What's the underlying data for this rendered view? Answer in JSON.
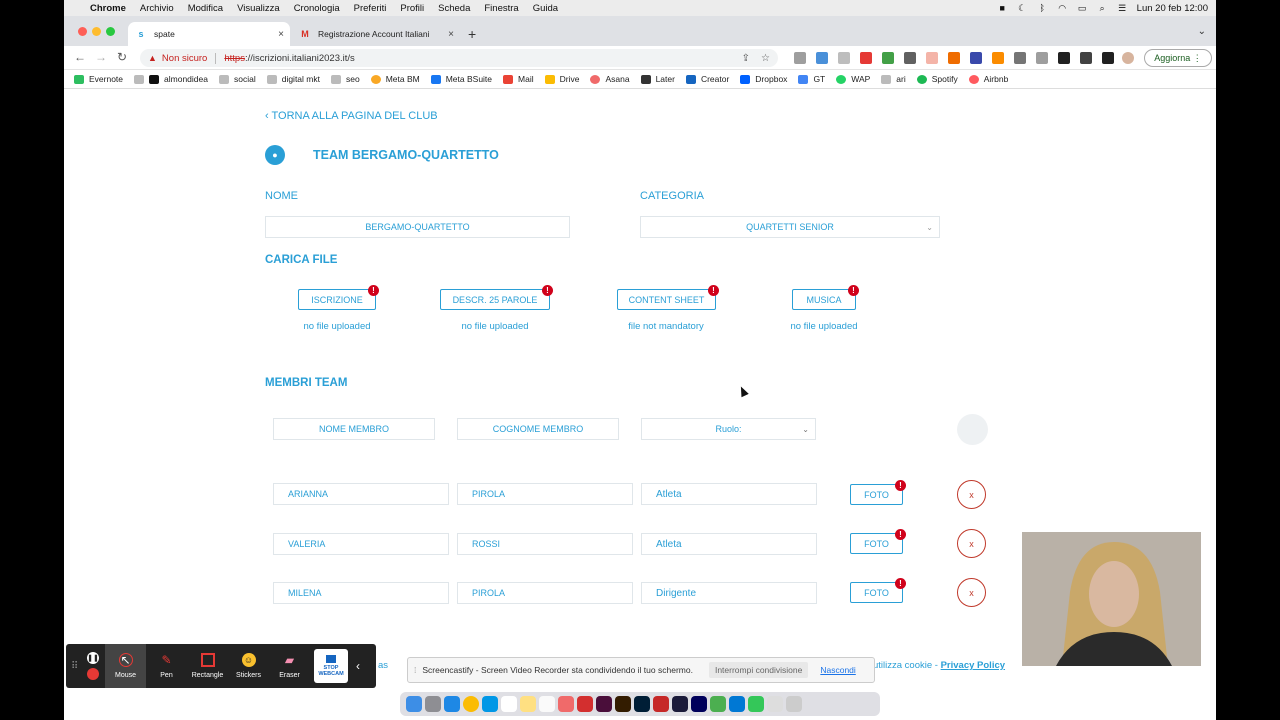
{
  "menubar": {
    "app": "Chrome",
    "items": [
      "Archivio",
      "Modifica",
      "Visualizza",
      "Cronologia",
      "Preferiti",
      "Profili",
      "Scheda",
      "Finestra",
      "Guida"
    ],
    "clock": "Lun 20 feb  12:00"
  },
  "browser": {
    "tabs": [
      {
        "title": "spate",
        "active": true
      },
      {
        "title": "Registrazione Account Italiani",
        "active": false
      }
    ],
    "security": "Non sicuro",
    "url_scheme": "https",
    "url_rest": "://iscrizioni.italiani2023.it/s",
    "update_button": "Aggiorna",
    "bookmarks": [
      "Evernote",
      "almondidea",
      "social",
      "digital mkt",
      "seo",
      "Meta BM",
      "Meta BSuite",
      "Mail",
      "Drive",
      "Asana",
      "Later",
      "Creator",
      "Dropbox",
      "GT",
      "WAP",
      "ari",
      "Spotify",
      "Airbnb"
    ]
  },
  "page": {
    "back_link": "‹ TORNA ALLA PAGINA DEL CLUB",
    "team_title": "TEAM BERGAMO-QUARTETTO",
    "nome_label": "NOME",
    "nome_value": "BERGAMO-QUARTETTO",
    "categoria_label": "CATEGORIA",
    "categoria_value": "QUARTETTI SENIOR",
    "carica_file": "CARICA FILE",
    "files": [
      {
        "label": "ISCRIZIONE",
        "status": "no file uploaded"
      },
      {
        "label": "DESCR. 25 PAROLE",
        "status": "no file uploaded"
      },
      {
        "label": "CONTENT SHEET",
        "status": "file not mandatory"
      },
      {
        "label": "MUSICA",
        "status": "no file uploaded"
      }
    ],
    "badge": "!",
    "membri_team": "MEMBRI TEAM",
    "new_member": {
      "nome_placeholder": "NOME MEMBRO",
      "cognome_placeholder": "COGNOME MEMBRO",
      "ruolo_placeholder": "Ruolo:"
    },
    "members": [
      {
        "nome": "ARIANNA",
        "cognome": "PIROLA",
        "ruolo": "Atleta"
      },
      {
        "nome": "VALERIA",
        "cognome": "ROSSI",
        "ruolo": "Atleta"
      },
      {
        "nome": "MILENA",
        "cognome": "PIROLA",
        "ruolo": "Dirigente"
      }
    ],
    "foto_label": "FOTO",
    "delete_label": "x",
    "cookie_left": "o di as",
    "cookie_right_prefix": "utilizza cookie - ",
    "cookie_right_link": "Privacy Policy"
  },
  "screencastify": {
    "tools": [
      "Mouse",
      "Pen",
      "Rectangle",
      "Stickers",
      "Eraser",
      "STOP WEBCAM"
    ],
    "banner": "Screencastify - Screen Video Recorder sta condividendo il tuo schermo.",
    "stop_share": "Interrompi condivisione",
    "hide": "Nascondi"
  },
  "colors": {
    "accent": "#2a9fd6",
    "danger": "#d0021b"
  }
}
